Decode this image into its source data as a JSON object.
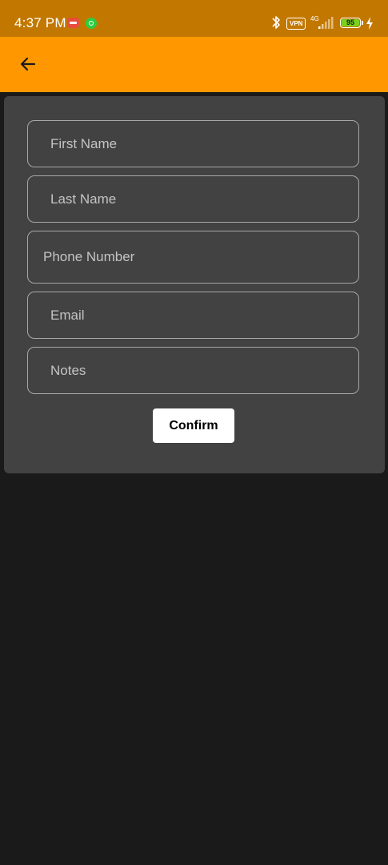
{
  "status_bar": {
    "time": "4:37 PM",
    "vpn_label": "VPN",
    "network_label": "4G",
    "battery_level": "95",
    "icons": [
      "message-notification-icon",
      "app-notification-icon",
      "bluetooth-icon",
      "vpn-icon",
      "signal-icon",
      "battery-icon",
      "charging-icon"
    ]
  },
  "app_bar": {
    "back_icon": "arrow-left-icon",
    "color": "#ff9800"
  },
  "form": {
    "first_name": {
      "placeholder": "First Name",
      "value": ""
    },
    "last_name": {
      "placeholder": "Last Name",
      "value": ""
    },
    "phone": {
      "placeholder": "Phone Number",
      "value": ""
    },
    "email": {
      "placeholder": "Email",
      "value": ""
    },
    "notes": {
      "placeholder": "Notes",
      "value": ""
    },
    "confirm_label": "Confirm"
  },
  "colors": {
    "status_bar": "#c27800",
    "accent": "#ff9800",
    "background": "#1a1a1a",
    "card": "#424242",
    "field_border": "#a7a7a7"
  }
}
